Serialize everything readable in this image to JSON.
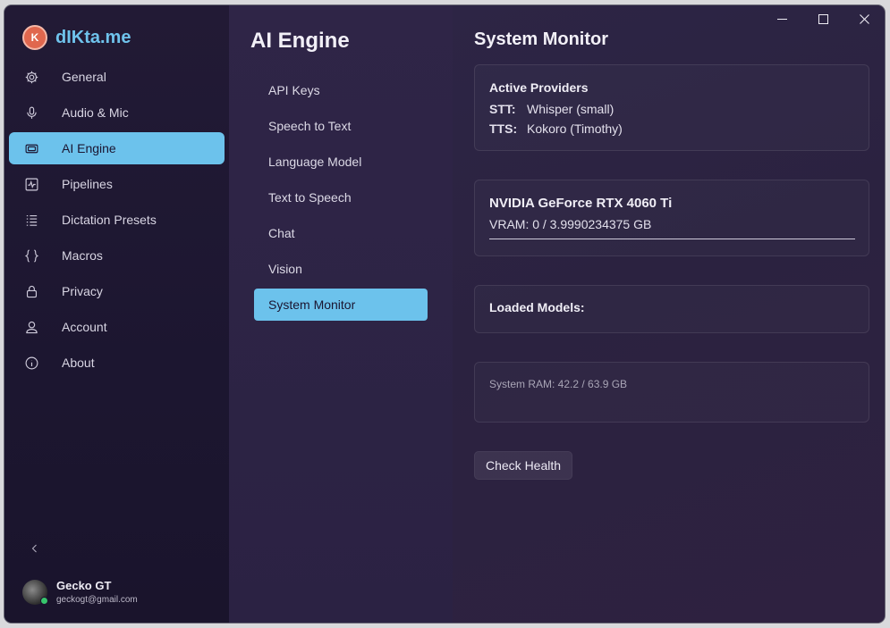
{
  "app": {
    "brand_name": "dIKta.me",
    "brand_logo_text": "K"
  },
  "sidebar": {
    "items": [
      {
        "label": "General",
        "icon": "gear-icon"
      },
      {
        "label": "Audio & Mic",
        "icon": "microphone-icon"
      },
      {
        "label": "AI Engine",
        "icon": "chip-icon",
        "active": true
      },
      {
        "label": "Pipelines",
        "icon": "pipeline-icon"
      },
      {
        "label": "Dictation Presets",
        "icon": "list-icon"
      },
      {
        "label": "Macros",
        "icon": "braces-icon"
      },
      {
        "label": "Privacy",
        "icon": "lock-icon"
      },
      {
        "label": "Account",
        "icon": "user-icon"
      },
      {
        "label": "About",
        "icon": "info-icon"
      }
    ],
    "collapse_icon": "chevron-left-icon"
  },
  "user": {
    "name": "Gecko GT",
    "email": "geckogt@gmail.com",
    "status_color": "#37c56c"
  },
  "middle": {
    "title": "AI Engine",
    "items": [
      {
        "label": "API Keys"
      },
      {
        "label": "Speech to Text"
      },
      {
        "label": "Language Model"
      },
      {
        "label": "Text to Speech"
      },
      {
        "label": "Chat"
      },
      {
        "label": "Vision"
      },
      {
        "label": "System Monitor",
        "active": true
      }
    ]
  },
  "content": {
    "title": "System Monitor",
    "providers": {
      "heading": "Active Providers",
      "stt_key": "STT:",
      "stt_value": "Whisper (small)",
      "tts_key": "TTS:",
      "tts_value": "Kokoro (Timothy)"
    },
    "gpu": {
      "name": "NVIDIA GeForce RTX 4060 Ti",
      "vram_text": "VRAM: 0 / 3.9990234375 GB",
      "vram_used_fraction": 0
    },
    "loaded_models": {
      "heading": "Loaded Models:"
    },
    "ram": {
      "text": "System RAM: 42.2 / 63.9 GB"
    },
    "check_health_label": "Check Health"
  },
  "colors": {
    "accent": "#6cc2ec",
    "brand_logo": "#e0674e",
    "brand_text": "#6fc3ec"
  }
}
